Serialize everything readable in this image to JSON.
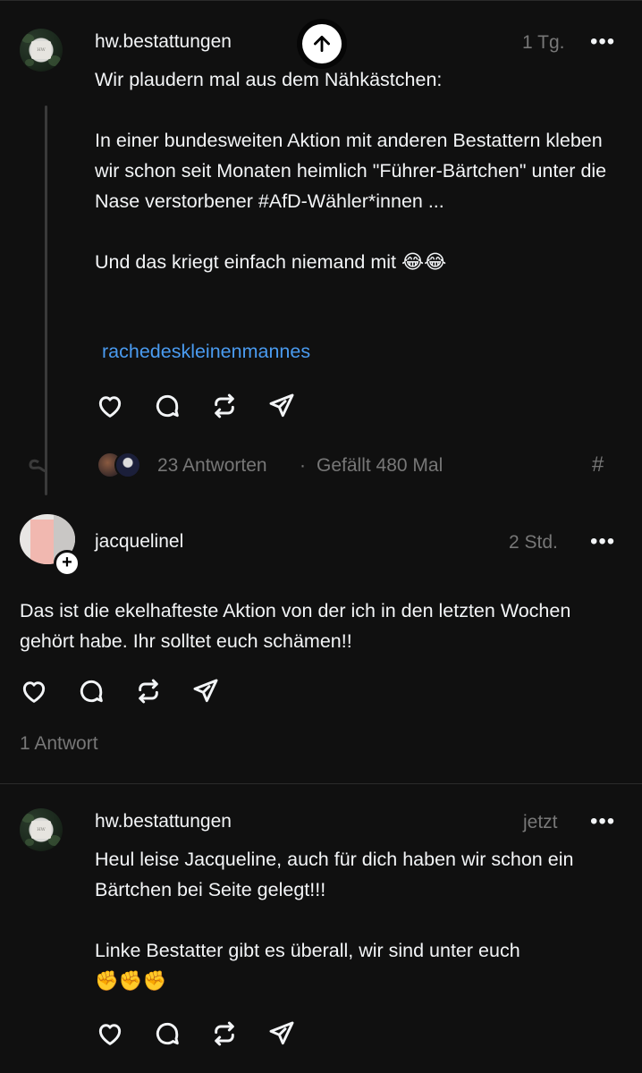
{
  "post1": {
    "username": "hw.bestattungen",
    "time": "1 Tg.",
    "more": "•••",
    "text": "Wir plaudern mal aus dem Nähkästchen:\n\nIn einer bundesweiten Aktion mit anderen Bestattern kleben wir schon seit Monaten heimlich \"Führer-Bärtchen\" unter die Nase verstorbener #AfD-Wähler*innen ...\n\nUnd das kriegt einfach niemand mit 😂😂",
    "hashtag": "rachedeskleinenmannes",
    "replies_text": "23 Antworten",
    "separator": "·",
    "likes_text": "Gefällt 480 Mal",
    "hash_symbol": "#"
  },
  "post2": {
    "username": "jacquelinel",
    "time": "2 Std.",
    "more": "•••",
    "text": "Das ist die ekelhafteste Aktion von der ich in den letzten Wochen gehört habe. Ihr solltet euch schämen!!",
    "replies_text": "1 Antwort",
    "follow_plus": "+"
  },
  "post3": {
    "username": "hw.bestattungen",
    "time": "jetzt",
    "more": "•••",
    "text": "Heul leise Jacqueline, auch für dich haben wir schon ein Bärtchen bei Seite gelegt!!!\n\nLinke Bestatter gibt es überall, wir sind unter euch\n✊✊✊"
  },
  "icons": {
    "like": "heart-icon",
    "comment": "comment-icon",
    "repost": "repost-icon",
    "share": "send-icon",
    "scroll_top": "arrow-up-icon"
  },
  "colors": {
    "background": "#101010",
    "text": "#f3f5f7",
    "muted": "#777777",
    "link": "#4a9bf0"
  }
}
